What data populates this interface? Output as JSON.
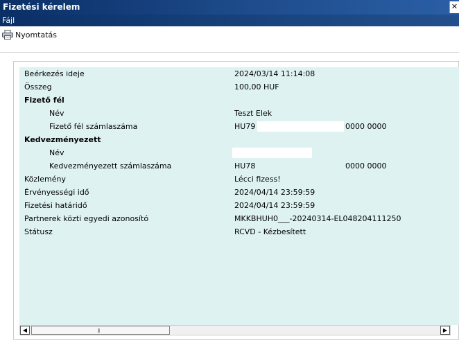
{
  "window": {
    "title": "Fizetési kérelem",
    "close_glyph": "✕"
  },
  "menu": {
    "items": [
      "Fájl"
    ]
  },
  "toolbar": {
    "print_label": "Nyomtatás",
    "print_icon": "printer-icon"
  },
  "details": {
    "received": {
      "label": "Beérkezés ideje",
      "value": "2024/03/14 11:14:08"
    },
    "amount": {
      "label": "Összeg",
      "value": "100,00 HUF"
    },
    "payer_section": "Fizető fél",
    "payer_name": {
      "label": "Név",
      "value": "Teszt Elek"
    },
    "payer_account": {
      "label": "Fizető fél számlaszáma",
      "value_start": "HU79",
      "value_end": "0000 0000"
    },
    "beneficiary_section": "Kedvezményezett",
    "beneficiary_name": {
      "label": "Név",
      "value": ""
    },
    "beneficiary_account": {
      "label": "Kedvezményezett számlaszáma",
      "value_start": "HU78",
      "value_end": "0000 0000"
    },
    "message": {
      "label": "Közlemény",
      "value": "Lécci fizess!"
    },
    "validity": {
      "label": "Érvényességi idő",
      "value": "2024/04/14 23:59:59"
    },
    "deadline": {
      "label": "Fizetési határidő",
      "value": "2024/04/14 23:59:59"
    },
    "partner_id": {
      "label": "Partnerek közti egyedi azonosító",
      "value": "MKKBHUH0___-20240314-EL048204111250"
    },
    "status": {
      "label": "Státusz",
      "value": "RCVD - Kézbesített"
    }
  },
  "scrollbar": {
    "left_arrow": "◀",
    "right_arrow": "▶",
    "grip": "⫴"
  }
}
